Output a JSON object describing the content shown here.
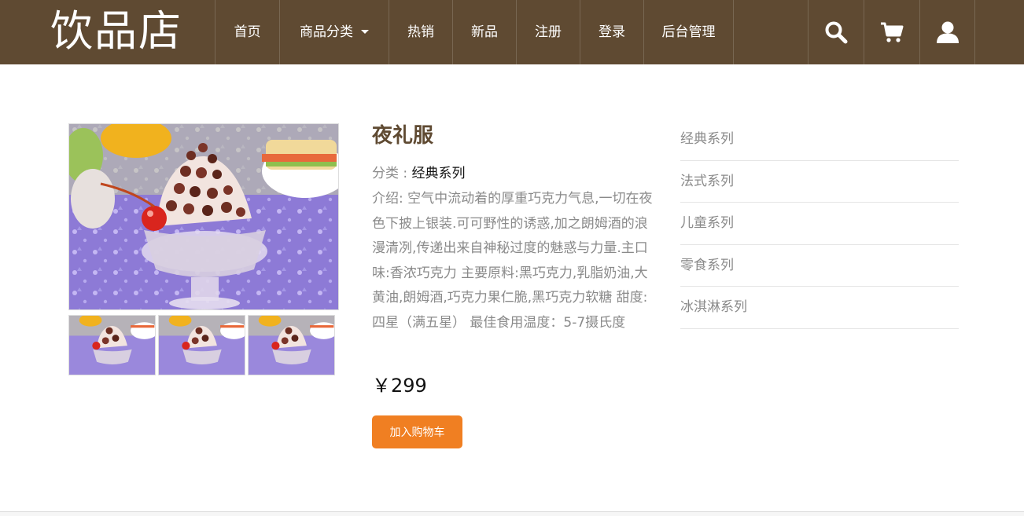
{
  "brand": "饮品店",
  "nav": {
    "items": [
      {
        "label": "首页"
      },
      {
        "label": "商品分类"
      },
      {
        "label": "热销"
      },
      {
        "label": "新品"
      },
      {
        "label": "注册"
      },
      {
        "label": "登录"
      },
      {
        "label": "后台管理"
      }
    ],
    "icons": [
      "search-icon",
      "cart-icon",
      "user-icon"
    ],
    "color": "#5f4a32"
  },
  "product": {
    "name": "夜礼服",
    "category_label": "分类 : ",
    "category": "经典系列",
    "intro": "介绍: 空气中流动着的厚重巧克力气息,一切在夜色下披上银装.可可野性的诱惑,加之朗姆酒的浪漫清冽,传递出来自神秘过度的魅惑与力量.主口味:香浓巧克力 主要原料:黑巧克力,乳脂奶油,大黄油,朗姆酒,巧克力果仁脆,黑巧克力软糖 甜度:四星（满五星） 最佳食用温度：5-7摄氏度",
    "price": "￥299",
    "add_to_cart_label": "加入购物车",
    "accent_color": "#f07f22"
  },
  "categories": [
    {
      "label": "经典系列"
    },
    {
      "label": "法式系列"
    },
    {
      "label": "儿童系列"
    },
    {
      "label": "零食系列"
    },
    {
      "label": "冰淇淋系列"
    }
  ]
}
